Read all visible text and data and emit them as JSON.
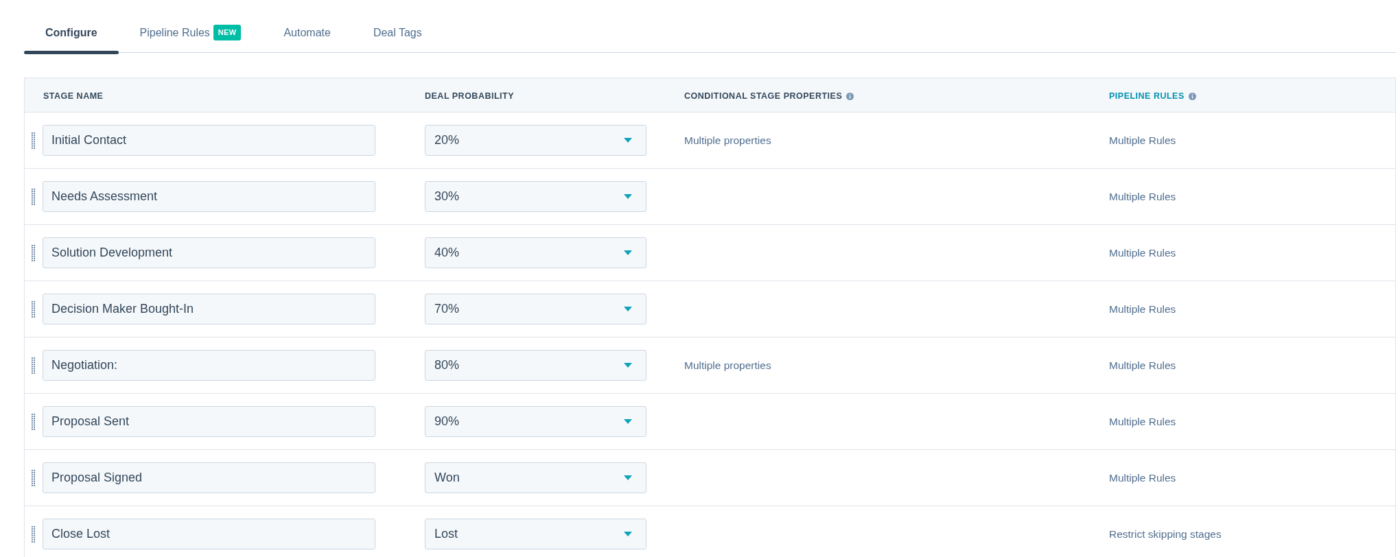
{
  "tabs": [
    {
      "label": "Configure",
      "selected": true
    },
    {
      "label": "Pipeline Rules",
      "selected": false,
      "badge": "NEW"
    },
    {
      "label": "Automate",
      "selected": false
    },
    {
      "label": "Deal Tags",
      "selected": false
    }
  ],
  "table": {
    "columns": [
      {
        "label": "STAGE NAME",
        "kind": "plain",
        "highlighted": false
      },
      {
        "label": "DEAL PROBABILITY",
        "kind": "plain",
        "highlighted": false
      },
      {
        "label": "CONDITIONAL STAGE PROPERTIES",
        "kind": "info",
        "highlighted": false
      },
      {
        "label": "PIPELINE RULES",
        "kind": "info",
        "highlighted": true
      }
    ],
    "rows": [
      {
        "stage_name": "Initial Contact",
        "deal_probability": "20%",
        "conditional_stage_properties": "Multiple properties",
        "pipeline_rules": "Multiple Rules"
      },
      {
        "stage_name": "Needs Assessment",
        "deal_probability": "30%",
        "pipeline_rules": "Multiple Rules"
      },
      {
        "stage_name": "Solution Development",
        "deal_probability": "40%",
        "pipeline_rules": "Multiple Rules"
      },
      {
        "stage_name": "Decision Maker Bought-In",
        "deal_probability": "70%",
        "pipeline_rules": "Multiple Rules"
      },
      {
        "stage_name": "Negotiation:",
        "deal_probability": "80%",
        "conditional_stage_properties": "Multiple properties",
        "pipeline_rules": "Multiple Rules"
      },
      {
        "stage_name": "Proposal Sent",
        "deal_probability": "90%",
        "pipeline_rules": "Multiple Rules"
      },
      {
        "stage_name": "Proposal Signed",
        "deal_probability": "Won",
        "pipeline_rules": "Multiple Rules"
      },
      {
        "stage_name": "Close Lost",
        "deal_probability": "Lost",
        "pipeline_rules": "Restrict skipping stages"
      }
    ]
  }
}
